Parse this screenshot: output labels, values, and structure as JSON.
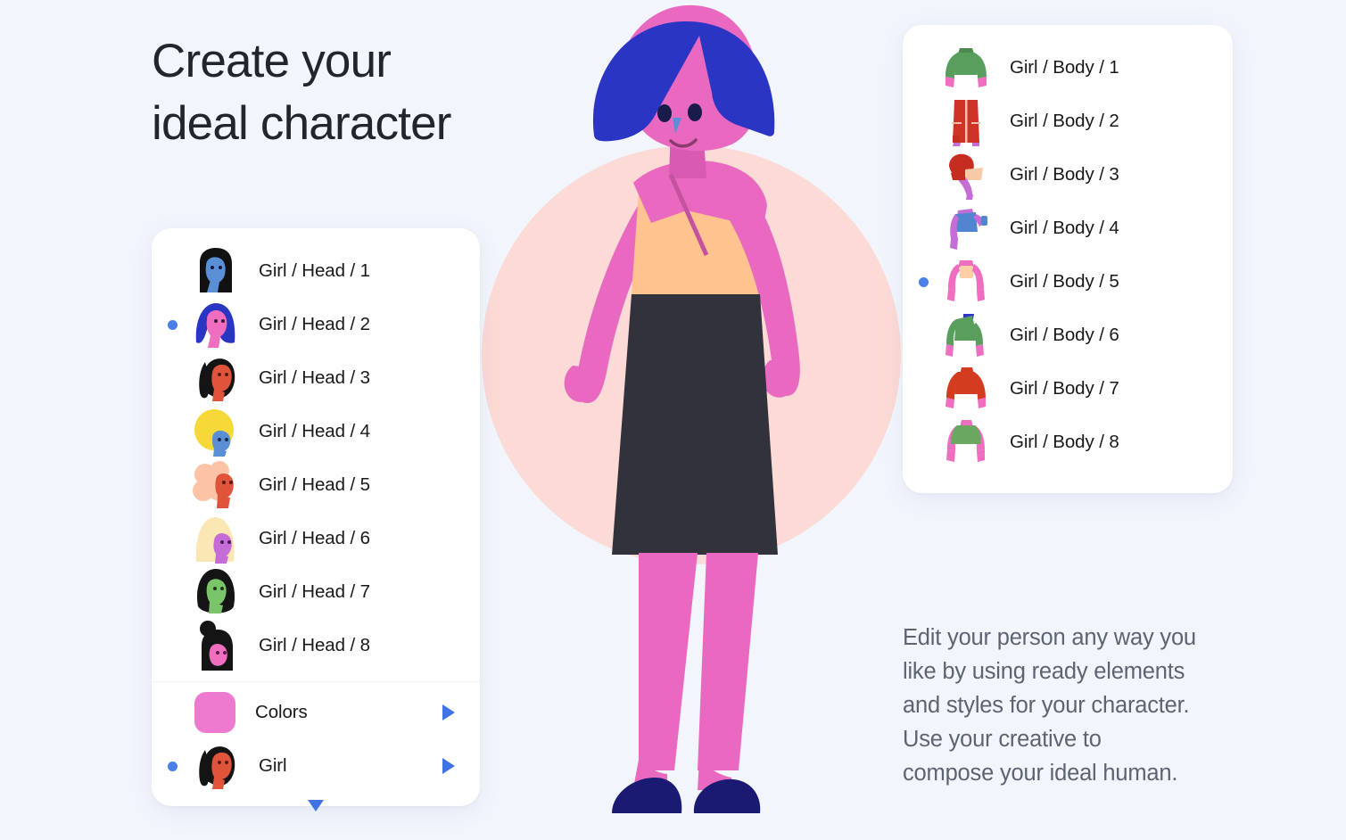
{
  "page": {
    "background_color": "#f2f5fc",
    "title": "Create your\nideal character",
    "title_color": "#22252b"
  },
  "stage": {
    "name": "character-preview",
    "circle_color": "#fcdad5",
    "character": {
      "hair_color": "#2a35c4",
      "skin_color": "#e968c0",
      "top_color": "#ffc38f",
      "skirt_color": "#32323c",
      "shoe_color": "#1b1a72"
    }
  },
  "head_panel": {
    "name": "head-options-panel",
    "items": [
      {
        "label": "Girl / Head / 1",
        "selected": false,
        "hair": "#111111",
        "face": "#5a8fd6",
        "style": "bob"
      },
      {
        "label": "Girl / Head / 2",
        "selected": true,
        "hair": "#2a35c4",
        "face": "#ef6ec0",
        "style": "bob"
      },
      {
        "label": "Girl / Head / 3",
        "selected": false,
        "hair": "#141414",
        "face": "#e0543b",
        "style": "ponytail"
      },
      {
        "label": "Girl / Head / 4",
        "selected": false,
        "hair": "#f5d938",
        "face": "#5a8fd6",
        "style": "round"
      },
      {
        "label": "Girl / Head / 5",
        "selected": false,
        "hair": "#fcc3a6",
        "face": "#e0543b",
        "style": "curly"
      },
      {
        "label": "Girl / Head / 6",
        "selected": false,
        "hair": "#fbe7b4",
        "face": "#c66cd6",
        "style": "long"
      },
      {
        "label": "Girl / Head / 7",
        "selected": false,
        "hair": "#141414",
        "face": "#7ac46a",
        "style": "long"
      },
      {
        "label": "Girl / Head / 8",
        "selected": false,
        "hair": "#141414",
        "face": "#ef6ec0",
        "style": "bun"
      }
    ],
    "footer": [
      {
        "label": "Colors",
        "selected": false,
        "type": "swatch",
        "swatch_color": "#ee7ad0",
        "arrow": "chevron-right"
      },
      {
        "label": "Girl",
        "selected": true,
        "type": "avatar",
        "hair": "#141414",
        "face": "#e0543b",
        "arrow": "chevron-right"
      }
    ],
    "expand_arrow": "chevron-down"
  },
  "body_panel": {
    "name": "body-options-panel",
    "items": [
      {
        "label": "Girl / Body / 1",
        "selected": false,
        "shirt": "#5a9e5e",
        "skin": "#ef6ec0",
        "style": "tee"
      },
      {
        "label": "Girl / Body / 2",
        "selected": false,
        "shirt": "#cf3326",
        "skin": "#ef6ec0",
        "style": "coat"
      },
      {
        "label": "Girl / Body / 3",
        "selected": false,
        "shirt": "#c42d20",
        "skin": "#f8c9a6",
        "style": "lean"
      },
      {
        "label": "Girl / Body / 4",
        "selected": false,
        "shirt": "#4f86cf",
        "skin": "#c56cd6",
        "style": "lean"
      },
      {
        "label": "Girl / Body / 5",
        "selected": true,
        "shirt": "#ef6ec0",
        "skin": "#ffd0a8",
        "style": "tee"
      },
      {
        "label": "Girl / Body / 6",
        "selected": false,
        "shirt": "#5a9e5e",
        "skin": "#ef6ec0",
        "style": "collar"
      },
      {
        "label": "Girl / Body / 7",
        "selected": false,
        "shirt": "#d43c1f",
        "skin": "#ef6ec0",
        "style": "tee"
      },
      {
        "label": "Girl / Body / 8",
        "selected": false,
        "shirt": "#6aa862",
        "skin": "#ef6ec0",
        "style": "tee"
      }
    ]
  },
  "description": {
    "text": "Edit your person any way you\nlike by using ready elements\nand styles for your character.\nUse your creative to\ncompose your ideal human.",
    "color": "#5d6470"
  },
  "accent": {
    "selection_dot": "#4a7fe8",
    "arrow": "#3f73e3"
  }
}
